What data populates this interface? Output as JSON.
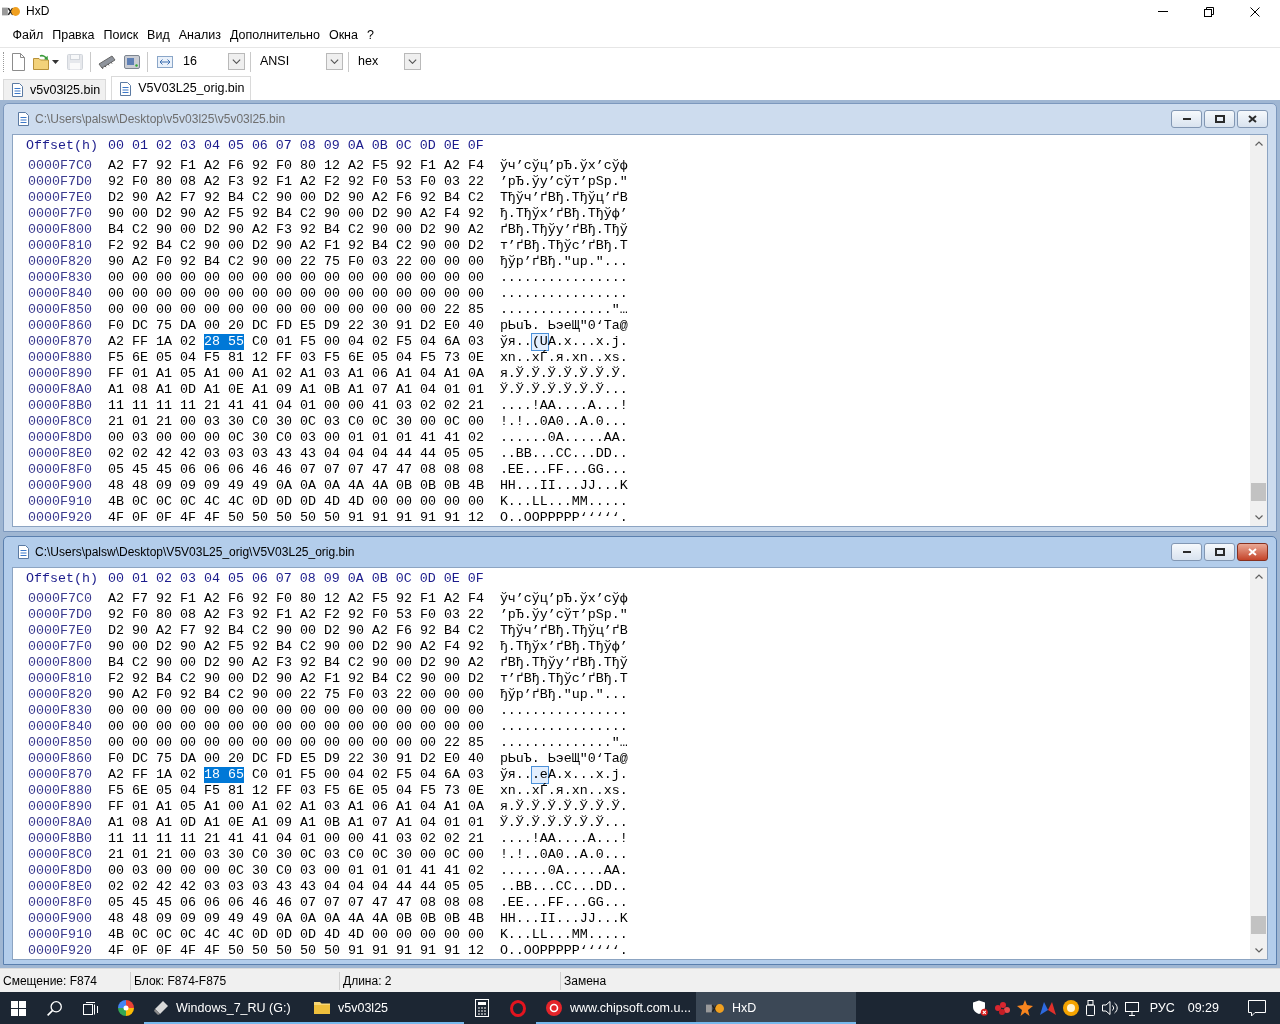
{
  "window": {
    "title": "HxD"
  },
  "menu": [
    "Файл",
    "Правка",
    "Поиск",
    "Вид",
    "Анализ",
    "Дополнительно",
    "Окна",
    "?"
  ],
  "toolbar": {
    "button_groups": [
      [
        {
          "kind": "new",
          "disabled": false,
          "dropdown": false
        },
        {
          "kind": "open",
          "disabled": false,
          "dropdown": true
        },
        {
          "kind": "save",
          "disabled": true,
          "dropdown": false
        }
      ],
      [
        {
          "kind": "ram",
          "disabled": false,
          "dropdown": false
        },
        {
          "kind": "disk",
          "disabled": false,
          "dropdown": false
        }
      ]
    ],
    "selects": [
      {
        "kind": "bytes-per-row",
        "value": "16"
      },
      {
        "kind": "charset",
        "value": "ANSI"
      },
      {
        "kind": "offset-base",
        "value": "hex"
      }
    ]
  },
  "tabs": [
    {
      "label": "v5v03l25.bin",
      "selected": false
    },
    {
      "label": "V5V03L25_orig.bin",
      "selected": true
    }
  ],
  "editors": [
    {
      "title": "C:\\Users\\palsw\\Desktop\\v5v03l25\\v5v03l25.bin",
      "active": false,
      "header": {
        "offset": "Offset(h)",
        "columns": [
          "00",
          "01",
          "02",
          "03",
          "04",
          "05",
          "06",
          "07",
          "08",
          "09",
          "0A",
          "0B",
          "0C",
          "0D",
          "0E",
          "0F"
        ]
      },
      "rows": [
        {
          "offset": "0000F7C0",
          "hex": [
            {
              "text": "A2 F7 92 F1 A2 F6 92 F0 80 12 A2 F5 92 F1 A2 F4",
              "selected": false
            }
          ],
          "ansi": [
            {
              "text": "ўч’сўц’рЂ.ўх’сўф",
              "selected": false
            }
          ]
        },
        {
          "offset": "0000F7D0",
          "hex": [
            {
              "text": "92 F0 80 08 A2 F3 92 F1 A2 F2 92 F0 53 F0 03 22",
              "selected": false
            }
          ],
          "ansi": [
            {
              "text": "’рЂ.ўу’сўт’рSр.\"",
              "selected": false
            }
          ]
        },
        {
          "offset": "0000F7E0",
          "hex": [
            {
              "text": "D2 90 A2 F7 92 B4 C2 90 00 D2 90 A2 F6 92 B4 C2",
              "selected": false
            }
          ],
          "ansi": [
            {
              "text": "Тђўч’ґВђ.Тђўц’ґВ",
              "selected": false
            }
          ]
        },
        {
          "offset": "0000F7F0",
          "hex": [
            {
              "text": "90 00 D2 90 A2 F5 92 B4 C2 90 00 D2 90 A2 F4 92",
              "selected": false
            }
          ],
          "ansi": [
            {
              "text": "ђ.Тђўх’ґВђ.Тђўф’",
              "selected": false
            }
          ]
        },
        {
          "offset": "0000F800",
          "hex": [
            {
              "text": "B4 C2 90 00 D2 90 A2 F3 92 B4 C2 90 00 D2 90 A2",
              "selected": false
            }
          ],
          "ansi": [
            {
              "text": "ґВђ.Тђўу’ґВђ.Тђў",
              "selected": false
            }
          ]
        },
        {
          "offset": "0000F810",
          "hex": [
            {
              "text": "F2 92 B4 C2 90 00 D2 90 A2 F1 92 B4 C2 90 00 D2",
              "selected": false
            }
          ],
          "ansi": [
            {
              "text": "т’ґВђ.Тђўс’ґВђ.Т",
              "selected": false
            }
          ]
        },
        {
          "offset": "0000F820",
          "hex": [
            {
              "text": "90 A2 F0 92 B4 C2 90 00 22 75 F0 03 22 00 00 00",
              "selected": false
            }
          ],
          "ansi": [
            {
              "text": "ђўр’ґВђ.\"uр.\"...",
              "selected": false
            }
          ]
        },
        {
          "offset": "0000F830",
          "hex": [
            {
              "text": "00 00 00 00 00 00 00 00 00 00 00 00 00 00 00 00",
              "selected": false
            }
          ],
          "ansi": [
            {
              "text": "................",
              "selected": false
            }
          ]
        },
        {
          "offset": "0000F840",
          "hex": [
            {
              "text": "00 00 00 00 00 00 00 00 00 00 00 00 00 00 00 00",
              "selected": false
            }
          ],
          "ansi": [
            {
              "text": "................",
              "selected": false
            }
          ]
        },
        {
          "offset": "0000F850",
          "hex": [
            {
              "text": "00 00 00 00 00 00 00 00 00 00 00 00 00 00 22 85",
              "selected": false
            }
          ],
          "ansi": [
            {
              "text": "..............\"…",
              "selected": false
            }
          ]
        },
        {
          "offset": "0000F860",
          "hex": [
            {
              "text": "F0 DC 75 DA 00 20 DC FD E5 D9 22 30 91 D2 E0 40",
              "selected": false
            }
          ],
          "ansi": [
            {
              "text": "рЬuЪ. ЬэеЩ\"0‘Та@",
              "selected": false
            }
          ]
        },
        {
          "offset": "0000F870",
          "hex": [
            {
              "text": "A2 FF 1A 02",
              "selected": false
            },
            {
              "text": "28 55",
              "selected": true
            },
            {
              "text": "C0 01 F5 00 04 02 F5 04 6A 03",
              "selected": false
            }
          ],
          "ansi": [
            {
              "text": "ўя..",
              "selected": false
            },
            {
              "text": "(U",
              "selected": true
            },
            {
              "text": "А.х...х.j.",
              "selected": false
            }
          ]
        },
        {
          "offset": "0000F880",
          "hex": [
            {
              "text": "F5 6E 05 04 F5 81 12 FF 03 F5 6E 05 04 F5 73 0E",
              "selected": false
            }
          ],
          "ansi": [
            {
              "text": "хn..хЃ.я.хn..хs.",
              "selected": false
            }
          ]
        },
        {
          "offset": "0000F890",
          "hex": [
            {
              "text": "FF 01 A1 05 A1 00 A1 02 A1 03 A1 06 A1 04 A1 0A",
              "selected": false
            }
          ],
          "ansi": [
            {
              "text": "я.Ў.Ў.Ў.Ў.Ў.Ў.Ў.",
              "selected": false
            }
          ]
        },
        {
          "offset": "0000F8A0",
          "hex": [
            {
              "text": "A1 08 A1 0D A1 0E A1 09 A1 0B A1 07 A1 04 01 01",
              "selected": false
            }
          ],
          "ansi": [
            {
              "text": "Ў.Ў.Ў.Ў.Ў.Ў.Ў...",
              "selected": false
            }
          ]
        },
        {
          "offset": "0000F8B0",
          "hex": [
            {
              "text": "11 11 11 11 21 41 41 04 01 00 00 41 03 02 02 21",
              "selected": false
            }
          ],
          "ansi": [
            {
              "text": "....!AA....A...!",
              "selected": false
            }
          ]
        },
        {
          "offset": "0000F8C0",
          "hex": [
            {
              "text": "21 01 21 00 03 30 C0 30 0C 03 C0 0C 30 00 0C 00",
              "selected": false
            }
          ],
          "ansi": [
            {
              "text": "!.!..0А0..А.0...",
              "selected": false
            }
          ]
        },
        {
          "offset": "0000F8D0",
          "hex": [
            {
              "text": "00 03 00 00 00 0C 30 C0 03 00 01 01 01 41 41 02",
              "selected": false
            }
          ],
          "ansi": [
            {
              "text": "......0А.....AA.",
              "selected": false
            }
          ]
        },
        {
          "offset": "0000F8E0",
          "hex": [
            {
              "text": "02 02 42 42 03 03 03 43 43 04 04 04 44 44 05 05",
              "selected": false
            }
          ],
          "ansi": [
            {
              "text": "..BB...CC...DD..",
              "selected": false
            }
          ]
        },
        {
          "offset": "0000F8F0",
          "hex": [
            {
              "text": "05 45 45 06 06 06 46 46 07 07 07 47 47 08 08 08",
              "selected": false
            }
          ],
          "ansi": [
            {
              "text": ".EE...FF...GG...",
              "selected": false
            }
          ]
        },
        {
          "offset": "0000F900",
          "hex": [
            {
              "text": "48 48 09 09 09 49 49 0A 0A 0A 4A 4A 0B 0B 0B 4B",
              "selected": false
            }
          ],
          "ansi": [
            {
              "text": "HH...II...JJ...K",
              "selected": false
            }
          ]
        },
        {
          "offset": "0000F910",
          "hex": [
            {
              "text": "4B 0C 0C 0C 4C 4C 0D 0D 0D 4D 4D 00 00 00 00 00",
              "selected": false
            }
          ],
          "ansi": [
            {
              "text": "K...LL...MM.....",
              "selected": false
            }
          ]
        },
        {
          "offset": "0000F920",
          "hex": [
            {
              "text": "4F 0F 0F 4F 4F 50 50 50 50 50 91 91 91 91 91 12",
              "selected": false
            }
          ],
          "ansi": [
            {
              "text": "O..OOPPPPP‘‘‘‘‘.",
              "selected": false
            }
          ]
        }
      ]
    },
    {
      "title": "C:\\Users\\palsw\\Desktop\\V5V03L25_orig\\V5V03L25_orig.bin",
      "active": true,
      "header": {
        "offset": "Offset(h)",
        "columns": [
          "00",
          "01",
          "02",
          "03",
          "04",
          "05",
          "06",
          "07",
          "08",
          "09",
          "0A",
          "0B",
          "0C",
          "0D",
          "0E",
          "0F"
        ]
      },
      "rows": [
        {
          "offset": "0000F7C0",
          "hex": [
            {
              "text": "A2 F7 92 F1 A2 F6 92 F0 80 12 A2 F5 92 F1 A2 F4",
              "selected": false
            }
          ],
          "ansi": [
            {
              "text": "ўч’сўц’рЂ.ўх’сўф",
              "selected": false
            }
          ]
        },
        {
          "offset": "0000F7D0",
          "hex": [
            {
              "text": "92 F0 80 08 A2 F3 92 F1 A2 F2 92 F0 53 F0 03 22",
              "selected": false
            }
          ],
          "ansi": [
            {
              "text": "’рЂ.ўу’сўт’рSр.\"",
              "selected": false
            }
          ]
        },
        {
          "offset": "0000F7E0",
          "hex": [
            {
              "text": "D2 90 A2 F7 92 B4 C2 90 00 D2 90 A2 F6 92 B4 C2",
              "selected": false
            }
          ],
          "ansi": [
            {
              "text": "Тђўч’ґВђ.Тђўц’ґВ",
              "selected": false
            }
          ]
        },
        {
          "offset": "0000F7F0",
          "hex": [
            {
              "text": "90 00 D2 90 A2 F5 92 B4 C2 90 00 D2 90 A2 F4 92",
              "selected": false
            }
          ],
          "ansi": [
            {
              "text": "ђ.Тђўх’ґВђ.Тђўф’",
              "selected": false
            }
          ]
        },
        {
          "offset": "0000F800",
          "hex": [
            {
              "text": "B4 C2 90 00 D2 90 A2 F3 92 B4 C2 90 00 D2 90 A2",
              "selected": false
            }
          ],
          "ansi": [
            {
              "text": "ґВђ.Тђўу’ґВђ.Тђў",
              "selected": false
            }
          ]
        },
        {
          "offset": "0000F810",
          "hex": [
            {
              "text": "F2 92 B4 C2 90 00 D2 90 A2 F1 92 B4 C2 90 00 D2",
              "selected": false
            }
          ],
          "ansi": [
            {
              "text": "т’ґВђ.Тђўс’ґВђ.Т",
              "selected": false
            }
          ]
        },
        {
          "offset": "0000F820",
          "hex": [
            {
              "text": "90 A2 F0 92 B4 C2 90 00 22 75 F0 03 22 00 00 00",
              "selected": false
            }
          ],
          "ansi": [
            {
              "text": "ђўр’ґВђ.\"uр.\"...",
              "selected": false
            }
          ]
        },
        {
          "offset": "0000F830",
          "hex": [
            {
              "text": "00 00 00 00 00 00 00 00 00 00 00 00 00 00 00 00",
              "selected": false
            }
          ],
          "ansi": [
            {
              "text": "................",
              "selected": false
            }
          ]
        },
        {
          "offset": "0000F840",
          "hex": [
            {
              "text": "00 00 00 00 00 00 00 00 00 00 00 00 00 00 00 00",
              "selected": false
            }
          ],
          "ansi": [
            {
              "text": "................",
              "selected": false
            }
          ]
        },
        {
          "offset": "0000F850",
          "hex": [
            {
              "text": "00 00 00 00 00 00 00 00 00 00 00 00 00 00 22 85",
              "selected": false
            }
          ],
          "ansi": [
            {
              "text": "..............\"…",
              "selected": false
            }
          ]
        },
        {
          "offset": "0000F860",
          "hex": [
            {
              "text": "F0 DC 75 DA 00 20 DC FD E5 D9 22 30 91 D2 E0 40",
              "selected": false
            }
          ],
          "ansi": [
            {
              "text": "рЬuЪ. ЬэеЩ\"0‘Та@",
              "selected": false
            }
          ]
        },
        {
          "offset": "0000F870",
          "hex": [
            {
              "text": "A2 FF 1A 02",
              "selected": false
            },
            {
              "text": "18 65",
              "selected": true
            },
            {
              "text": "C0 01 F5 00 04 02 F5 04 6A 03",
              "selected": false
            }
          ],
          "ansi": [
            {
              "text": "ўя..",
              "selected": false
            },
            {
              "text": ".e",
              "selected": true
            },
            {
              "text": "А.х...х.j.",
              "selected": false
            }
          ]
        },
        {
          "offset": "0000F880",
          "hex": [
            {
              "text": "F5 6E 05 04 F5 81 12 FF 03 F5 6E 05 04 F5 73 0E",
              "selected": false
            }
          ],
          "ansi": [
            {
              "text": "хn..хЃ.я.хn..хs.",
              "selected": false
            }
          ]
        },
        {
          "offset": "0000F890",
          "hex": [
            {
              "text": "FF 01 A1 05 A1 00 A1 02 A1 03 A1 06 A1 04 A1 0A",
              "selected": false
            }
          ],
          "ansi": [
            {
              "text": "я.Ў.Ў.Ў.Ў.Ў.Ў.Ў.",
              "selected": false
            }
          ]
        },
        {
          "offset": "0000F8A0",
          "hex": [
            {
              "text": "A1 08 A1 0D A1 0E A1 09 A1 0B A1 07 A1 04 01 01",
              "selected": false
            }
          ],
          "ansi": [
            {
              "text": "Ў.Ў.Ў.Ў.Ў.Ў.Ў...",
              "selected": false
            }
          ]
        },
        {
          "offset": "0000F8B0",
          "hex": [
            {
              "text": "11 11 11 11 21 41 41 04 01 00 00 41 03 02 02 21",
              "selected": false
            }
          ],
          "ansi": [
            {
              "text": "....!AA....A...!",
              "selected": false
            }
          ]
        },
        {
          "offset": "0000F8C0",
          "hex": [
            {
              "text": "21 01 21 00 03 30 C0 30 0C 03 C0 0C 30 00 0C 00",
              "selected": false
            }
          ],
          "ansi": [
            {
              "text": "!.!..0А0..А.0...",
              "selected": false
            }
          ]
        },
        {
          "offset": "0000F8D0",
          "hex": [
            {
              "text": "00 03 00 00 00 0C 30 C0 03 00 01 01 01 41 41 02",
              "selected": false
            }
          ],
          "ansi": [
            {
              "text": "......0А.....AA.",
              "selected": false
            }
          ]
        },
        {
          "offset": "0000F8E0",
          "hex": [
            {
              "text": "02 02 42 42 03 03 03 43 43 04 04 04 44 44 05 05",
              "selected": false
            }
          ],
          "ansi": [
            {
              "text": "..BB...CC...DD..",
              "selected": false
            }
          ]
        },
        {
          "offset": "0000F8F0",
          "hex": [
            {
              "text": "05 45 45 06 06 06 46 46 07 07 07 47 47 08 08 08",
              "selected": false
            }
          ],
          "ansi": [
            {
              "text": ".EE...FF...GG...",
              "selected": false
            }
          ]
        },
        {
          "offset": "0000F900",
          "hex": [
            {
              "text": "48 48 09 09 09 49 49 0A 0A 0A 4A 4A 0B 0B 0B 4B",
              "selected": false
            }
          ],
          "ansi": [
            {
              "text": "HH...II...JJ...K",
              "selected": false
            }
          ]
        },
        {
          "offset": "0000F910",
          "hex": [
            {
              "text": "4B 0C 0C 0C 4C 4C 0D 0D 0D 4D 4D 00 00 00 00 00",
              "selected": false
            }
          ],
          "ansi": [
            {
              "text": "K...LL...MM.....",
              "selected": false
            }
          ]
        },
        {
          "offset": "0000F920",
          "hex": [
            {
              "text": "4F 0F 0F 4F 4F 50 50 50 50 50 91 91 91 91 91 12",
              "selected": false
            }
          ],
          "ansi": [
            {
              "text": "O..OOPPPPP‘‘‘‘‘.",
              "selected": false
            }
          ]
        }
      ]
    }
  ],
  "status_bar": [
    "Смещение: F874",
    "Блок: F874-F875",
    "Длина: 2",
    "Замена"
  ],
  "taskbar": {
    "buttons": [
      {
        "kind": "start",
        "running": false,
        "selected": false
      },
      {
        "kind": "search",
        "running": false,
        "selected": false
      },
      {
        "kind": "task-view",
        "running": false,
        "selected": false
      },
      {
        "kind": "pinwheel",
        "running": false,
        "selected": false
      },
      {
        "kind": "usb-drive",
        "label": "Windows_7_RU (G:)",
        "running": true,
        "selected": false
      },
      {
        "kind": "folder",
        "label": "v5v03l25",
        "running": true,
        "selected": false
      },
      {
        "kind": "calculator",
        "running": false,
        "selected": false
      },
      {
        "kind": "ring",
        "running": false,
        "selected": false
      },
      {
        "kind": "browser",
        "label": "www.chipsoft.com.u...",
        "running": true,
        "selected": false
      },
      {
        "kind": "hxd",
        "label": "HxD",
        "running": true,
        "selected": true
      }
    ],
    "language": "РУС",
    "clock": "09:29"
  }
}
